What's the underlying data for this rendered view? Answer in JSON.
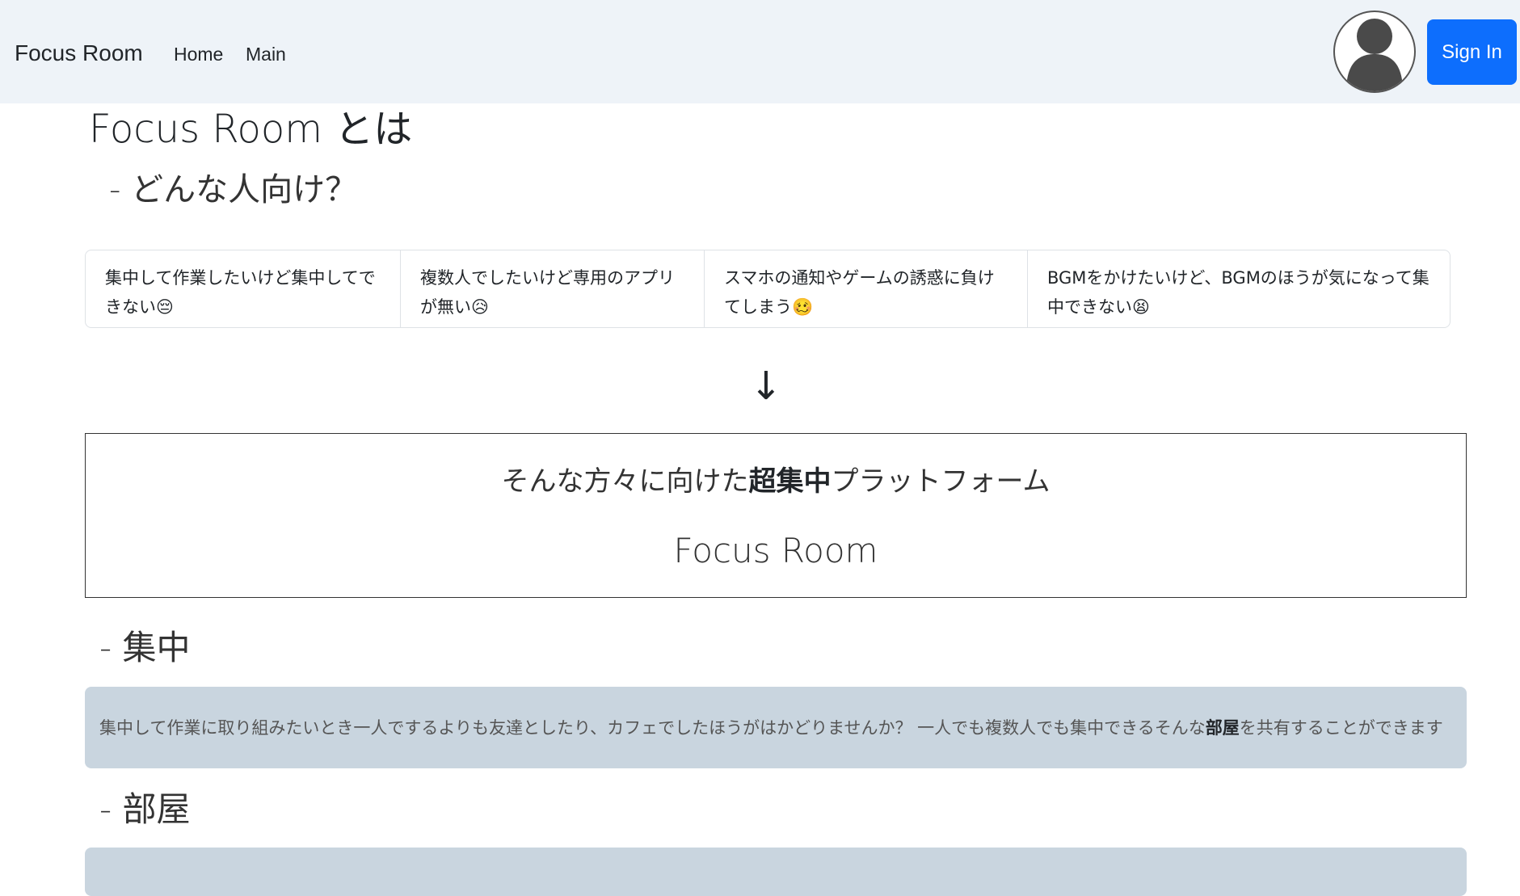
{
  "navbar": {
    "brand": "Focus Room",
    "links": [
      "Home",
      "Main"
    ],
    "signin_label": "Sign In"
  },
  "about": {
    "title": "Focus Room とは",
    "subtitle": "- どんな人向け？"
  },
  "target_list": [
    {
      "text": "集中して作業したいけど集中してできない",
      "emoji": "😔"
    },
    {
      "text": "複数人でしたいけど専用のアプリが無い",
      "emoji": "😥"
    },
    {
      "text": "スマホの通知やゲームの誘惑に負けてしまう",
      "emoji": "🥴"
    },
    {
      "text": "BGMをかけたいけど、BGMのほうが気になって集中できない",
      "emoji": "😫"
    }
  ],
  "arrow": "↓",
  "hero": {
    "prefix": "そんな方々に向けた",
    "emphasis": "超集中",
    "suffix": "プラットフォーム",
    "name": "Focus Room"
  },
  "sections": {
    "focus": {
      "heading": "- 集中",
      "body_prefix": "集中して作業に取り組みたいとき一人でするよりも友達としたり、カフェでしたほうがはかどりませんか？ 一人でも複数人でも集中できるそんな",
      "body_emphasis": "部屋",
      "body_suffix": "を共有することができます"
    },
    "room": {
      "heading": "- 部屋"
    }
  },
  "colors": {
    "navbar_bg": "#eef3f8",
    "primary": "#0d6efd",
    "info_box_bg": "#c9d5df"
  }
}
